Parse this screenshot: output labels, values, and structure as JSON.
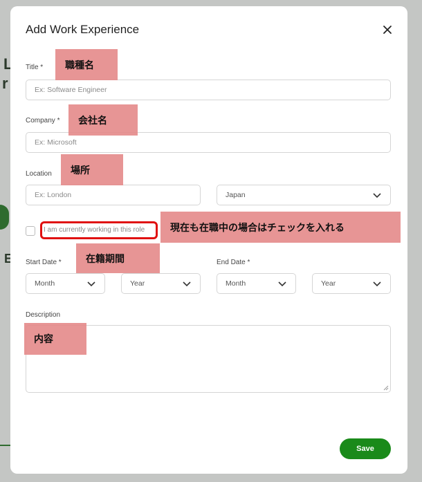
{
  "modal": {
    "title": "Add Work Experience",
    "close_icon": "close-icon",
    "save_label": "Save"
  },
  "background": {
    "frag1": "L",
    "frag2": "r",
    "frag3": "E"
  },
  "fields": {
    "title": {
      "label": "Title *",
      "placeholder": "Ex: Software Engineer"
    },
    "company": {
      "label": "Company *",
      "placeholder": "Ex: Microsoft"
    },
    "location": {
      "label": "Location",
      "placeholder": "Ex: London",
      "country": "Japan"
    },
    "current_role": {
      "label": "I am currently working in this role"
    },
    "start_date": {
      "label": "Start Date *",
      "month": "Month",
      "year": "Year"
    },
    "end_date": {
      "label": "End Date *",
      "month": "Month",
      "year": "Year"
    },
    "description": {
      "label": "Description"
    }
  },
  "annotations": {
    "title": "職種名",
    "company": "会社名",
    "location": "場所",
    "current": "現在も在職中の場合はチェックを入れる",
    "period": "在籍期間",
    "description": "内容"
  },
  "colors": {
    "accent": "#1a8a1a",
    "highlight": "#e01010",
    "annotation": "#e48a8a"
  }
}
